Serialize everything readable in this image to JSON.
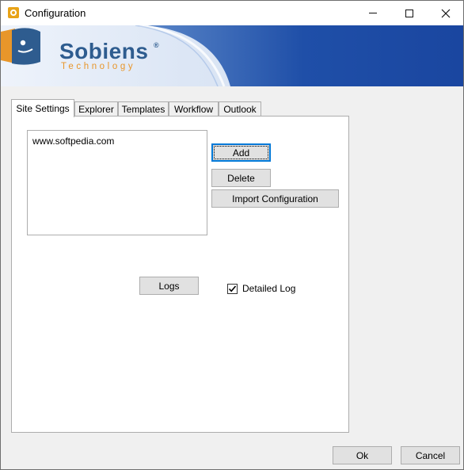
{
  "window": {
    "title": "Configuration",
    "controls": {
      "minimize": "minimize",
      "maximize": "maximize",
      "close": "close"
    }
  },
  "banner": {
    "brand_name": "Sobiens",
    "brand_registered": "®",
    "brand_subtitle": "Technology",
    "colors": {
      "brand_blue": "#2e5c8f",
      "brand_orange": "#e8962a",
      "banner_dark": "#1f4fa8"
    }
  },
  "tabs": [
    {
      "label": "Site Settings",
      "active": true
    },
    {
      "label": "Explorer",
      "active": false
    },
    {
      "label": "Templates",
      "active": false
    },
    {
      "label": "Workflow",
      "active": false
    },
    {
      "label": "Outlook",
      "active": false
    }
  ],
  "site_settings": {
    "sites_list": [
      "www.softpedia.com"
    ],
    "buttons": {
      "add": "Add",
      "delete": "Delete",
      "import": "Import Configuration",
      "logs": "Logs"
    },
    "detailed_log": {
      "label": "Detailed Log",
      "checked": true
    }
  },
  "footer": {
    "ok": "Ok",
    "cancel": "Cancel"
  }
}
